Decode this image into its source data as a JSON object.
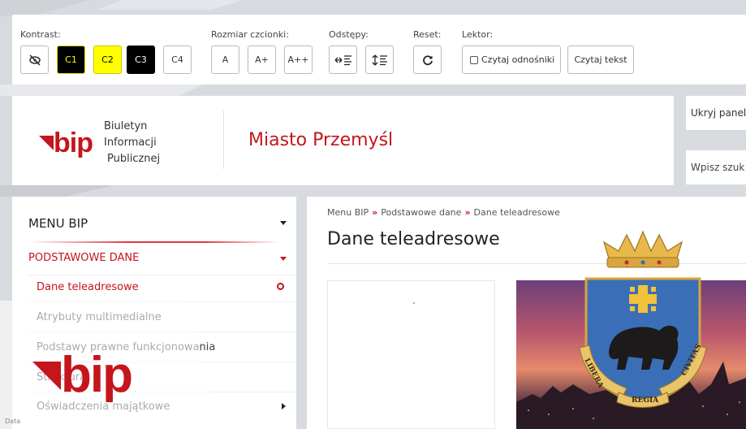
{
  "accessibility": {
    "contrast_label": "Kontrast:",
    "contrast_buttons": [
      "C1",
      "C2",
      "C3",
      "C4"
    ],
    "font_size_label": "Rozmiar czcionki:",
    "font_buttons": [
      "A",
      "A+",
      "A++"
    ],
    "spacing_label": "Odstępy:",
    "reset_label": "Reset:",
    "reader_label": "Lektor:",
    "read_links_label": "Czytaj odnośniki",
    "read_text_label": "Czytaj tekst"
  },
  "header": {
    "logo_text": "bip",
    "logo_subtitle": [
      "Biuletyn",
      "Informacji",
      "Publicznej"
    ],
    "site_title": "Miasto Przemyśl",
    "hide_panel_label": "Ukryj panel",
    "search_placeholder": "Wpisz szuk"
  },
  "menu": {
    "heading": "MENU BIP",
    "section": "PODSTAWOWE DANE",
    "items": [
      "Dane teleadresowe",
      "Atrybuty multimedialne",
      "Podstawy prawne funkcjonowania",
      "Struktura",
      "Oświadczenia majątkowe"
    ]
  },
  "content": {
    "breadcrumb": [
      "Menu BIP",
      "Podstawowe dane",
      "Dane teleadresowe"
    ],
    "breadcrumb_sep": "»",
    "page_title": "Dane teleadresowe",
    "coat_of_arms_text": [
      "LIBERA",
      "REGIA",
      "CIVITAS"
    ]
  },
  "footer_fragment": "Data",
  "colors": {
    "brand_red": "#c4161c",
    "contrast_yellow": "#ffff00",
    "contrast_black": "#000000"
  },
  "icons": [
    "hide-contrast-icon",
    "letter-spacing-icon",
    "line-spacing-icon",
    "refresh-icon",
    "chevron-down-icon",
    "active-dot-icon",
    "chevron-right-icon"
  ]
}
